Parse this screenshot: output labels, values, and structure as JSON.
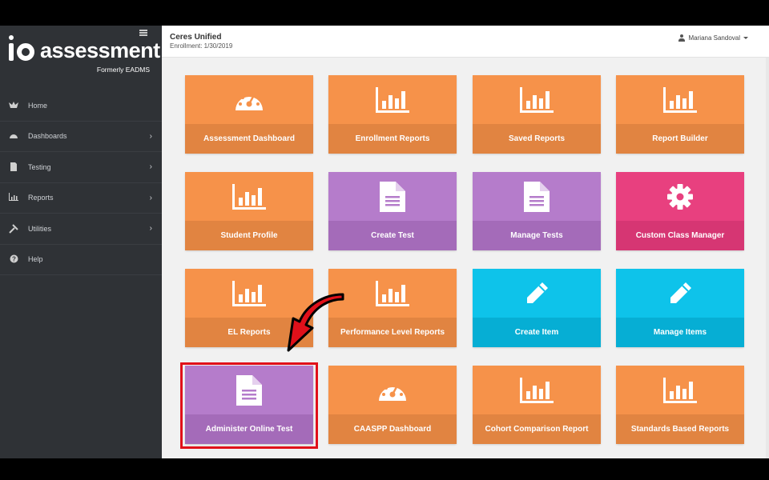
{
  "brand": {
    "logo_mark": "io",
    "name": "assessment",
    "subtitle": "Formerly EADMS"
  },
  "header": {
    "org_name": "Ceres Unified",
    "enrollment": "Enrollment: 1/30/2019",
    "user_name": "Mariana Sandoval"
  },
  "sidebar": {
    "items": [
      {
        "label": "Home",
        "icon": "home-icon",
        "has_children": false
      },
      {
        "label": "Dashboards",
        "icon": "dashboard-icon",
        "has_children": true
      },
      {
        "label": "Testing",
        "icon": "document-icon",
        "has_children": true
      },
      {
        "label": "Reports",
        "icon": "bar-chart-icon",
        "has_children": true
      },
      {
        "label": "Utilities",
        "icon": "tools-icon",
        "has_children": true
      },
      {
        "label": "Help",
        "icon": "help-icon",
        "has_children": false
      }
    ]
  },
  "tiles": [
    {
      "label": "Assessment Dashboard",
      "icon": "gauge-icon",
      "color": "orange"
    },
    {
      "label": "Enrollment Reports",
      "icon": "bar-chart-icon",
      "color": "orange"
    },
    {
      "label": "Saved Reports",
      "icon": "bar-chart-icon",
      "color": "orange"
    },
    {
      "label": "Report Builder",
      "icon": "bar-chart-icon",
      "color": "orange"
    },
    {
      "label": "Student Profile",
      "icon": "bar-chart-icon",
      "color": "orange"
    },
    {
      "label": "Create Test",
      "icon": "document-icon",
      "color": "purple"
    },
    {
      "label": "Manage Tests",
      "icon": "document-icon",
      "color": "purple"
    },
    {
      "label": "Custom Class Manager",
      "icon": "gear-icon",
      "color": "pink"
    },
    {
      "label": "EL Reports",
      "icon": "bar-chart-icon",
      "color": "orange"
    },
    {
      "label": "Performance Level Reports",
      "icon": "bar-chart-icon",
      "color": "orange"
    },
    {
      "label": "Create Item",
      "icon": "pencil-icon",
      "color": "blue"
    },
    {
      "label": "Manage Items",
      "icon": "pencil-icon",
      "color": "blue"
    },
    {
      "label": "Administer Online Test",
      "icon": "document-icon",
      "color": "purple"
    },
    {
      "label": "CAASPP Dashboard",
      "icon": "gauge-icon",
      "color": "orange"
    },
    {
      "label": "Cohort Comparison Report",
      "icon": "bar-chart-icon",
      "color": "orange"
    },
    {
      "label": "Standards Based Reports",
      "icon": "bar-chart-icon",
      "color": "orange"
    }
  ],
  "colors": {
    "orange": "#f6924a",
    "purple": "#b57ccb",
    "pink": "#e8407f",
    "blue": "#0ec3ea",
    "highlight": "#e0101a",
    "sidebar": "#2f3236"
  }
}
